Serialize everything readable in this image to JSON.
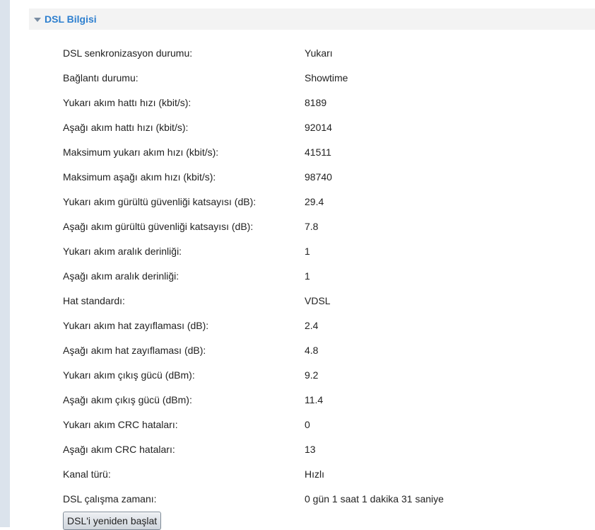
{
  "section": {
    "title": "DSL Bilgisi"
  },
  "rows": [
    {
      "label": "DSL senkronizasyon durumu:",
      "value": "Yukarı"
    },
    {
      "label": "Bağlantı durumu:",
      "value": "Showtime"
    },
    {
      "label": "Yukarı akım hattı hızı (kbit/s):",
      "value": "8189"
    },
    {
      "label": "Aşağı akım hattı hızı (kbit/s):",
      "value": "92014"
    },
    {
      "label": "Maksimum yukarı akım hızı (kbit/s):",
      "value": "41511"
    },
    {
      "label": "Maksimum aşağı akım hızı (kbit/s):",
      "value": "98740"
    },
    {
      "label": "Yukarı akım gürültü güvenliği katsayısı (dB):",
      "value": "29.4"
    },
    {
      "label": "Aşağı akım gürültü güvenliği katsayısı (dB):",
      "value": "7.8"
    },
    {
      "label": "Yukarı akım aralık derinliği:",
      "value": "1"
    },
    {
      "label": "Aşağı akım aralık derinliği:",
      "value": "1"
    },
    {
      "label": "Hat standardı:",
      "value": "VDSL"
    },
    {
      "label": "Yukarı akım hat zayıflaması (dB):",
      "value": "2.4"
    },
    {
      "label": "Aşağı akım hat zayıflaması (dB):",
      "value": "4.8"
    },
    {
      "label": "Yukarı akım çıkış gücü (dBm):",
      "value": "9.2"
    },
    {
      "label": "Aşağı akım çıkış gücü (dBm):",
      "value": "11.4"
    },
    {
      "label": "Yukarı akım CRC hataları:",
      "value": "0"
    },
    {
      "label": "Aşağı akım CRC hataları:",
      "value": "13"
    },
    {
      "label": "Kanal türü:",
      "value": "Hızlı"
    },
    {
      "label": "DSL çalışma zamanı:",
      "value": "0 gün 1 saat 1 dakika 31 saniye"
    }
  ],
  "actions": {
    "restart_label": "DSL'i yeniden başlat"
  },
  "colors": {
    "section_title": "#2d7fcf",
    "section_header_bg": "#f3f3f3",
    "left_strip": "#dbe3ec"
  },
  "icons": {
    "section_toggle": "caret-down-icon"
  }
}
